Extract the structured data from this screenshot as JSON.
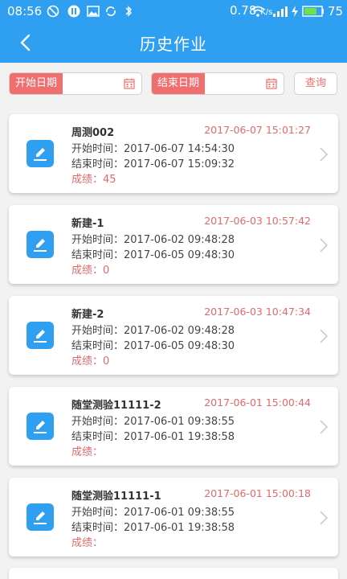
{
  "status_bar": {
    "time": "08:56",
    "speed_value": "0.78",
    "speed_unit": "K/s",
    "battery": "75"
  },
  "header": {
    "title": "历史作业"
  },
  "filter": {
    "start_label": "开始日期",
    "end_label": "结束日期",
    "search_label": "查询"
  },
  "records": [
    {
      "name": "周测002",
      "created": "2017-06-07 15:01:27",
      "start": "开始时间：2017-06-07 14:54:30",
      "end": "结束时间：2017-06-07 15:09:32",
      "score": "成绩：45"
    },
    {
      "name": "新建-1",
      "created": "2017-06-03 10:57:42",
      "start": "开始时间：2017-06-02 09:48:28",
      "end": "结束时间：2017-06-05 09:48:30",
      "score": "成绩：0"
    },
    {
      "name": "新建-2",
      "created": "2017-06-03 10:47:34",
      "start": "开始时间：2017-06-02 09:48:28",
      "end": "结束时间：2017-06-05 09:48:30",
      "score": "成绩：0"
    },
    {
      "name": "随堂测验11111-2",
      "created": "2017-06-01 15:00:44",
      "start": "开始时间：2017-06-01 09:38:55",
      "end": "结束时间：2017-06-01 19:38:58",
      "score": "成绩："
    },
    {
      "name": "随堂测验11111-1",
      "created": "2017-06-01 15:00:18",
      "start": "开始时间：2017-06-01 09:38:55",
      "end": "结束时间：2017-06-01 19:38:58",
      "score": "成绩："
    }
  ],
  "colors": {
    "primary": "#2f9ff1",
    "accent_red": "#ef6f6f"
  }
}
